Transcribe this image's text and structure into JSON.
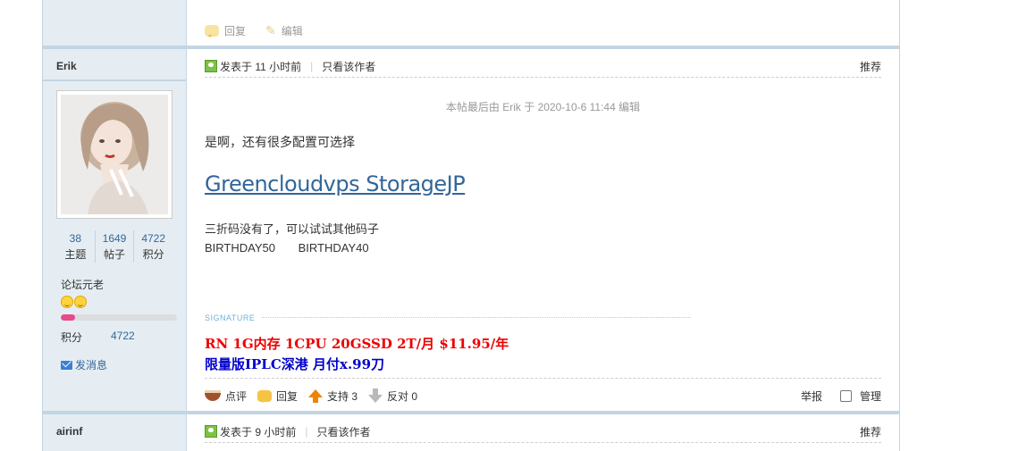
{
  "prev_post": {
    "reply_label": "回复",
    "edit_label": "编辑"
  },
  "post1": {
    "author": "Erik",
    "stats": [
      {
        "value": "38",
        "label": "主题"
      },
      {
        "value": "1649",
        "label": "帖子"
      },
      {
        "value": "4722",
        "label": "积分"
      }
    ],
    "rank": "论坛元老",
    "rank_progress": 0.12,
    "credit_label": "积分",
    "credit_value": "4722",
    "pm_label": "发消息",
    "posted": "发表于 11 小时前",
    "only_author": "只看该作者",
    "recommend": "推荐",
    "edit_note": "本帖最后由 Erik 于 2020-10-6 11:44 编辑",
    "text1": "是啊，还有很多配置可选择",
    "link": "Greencloudvps StorageJP",
    "text2": "三折码没有了，可以试试其他码子",
    "code1": "BIRTHDAY50",
    "code2": "BIRTHDAY40",
    "signature_label": "SIGNATURE",
    "sig_line1": "RN 1G内存 1CPU 20GSSD 2T/月 $11.95/年",
    "sig_line2": "限量版IPLC深港 月付x.99刀",
    "actions": {
      "comment": "点评",
      "reply": "回复",
      "support": "支持 3",
      "oppose": "反对 0",
      "report": "举报",
      "manage": "管理"
    }
  },
  "post2": {
    "author": "airinf",
    "posted": "发表于 9 小时前",
    "only_author": "只看该作者",
    "recommend": "推荐"
  },
  "colors": {
    "border": "#c2d5e3",
    "side_bg": "#e5edf2",
    "link": "#336699",
    "sig_red": "#ee0000",
    "sig_blue": "#0000cc"
  }
}
